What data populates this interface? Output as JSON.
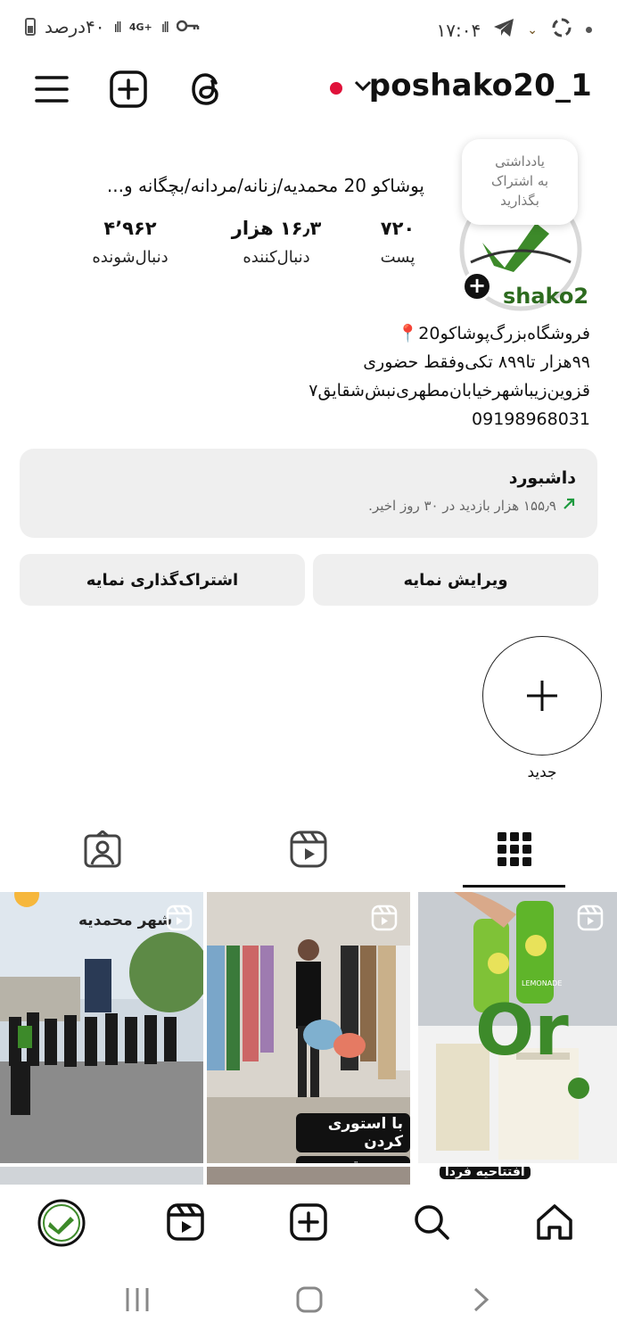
{
  "status_bar": {
    "battery_text": "۴۰درصد",
    "network": "4G+",
    "time": "۱۷:۰۴"
  },
  "header": {
    "username": "poshako20_1"
  },
  "note": {
    "text_line1": "یادداشتی",
    "text_line2": "به اشتراک",
    "text_line3": "بگذارید"
  },
  "avatar": {
    "label": "shako2"
  },
  "profile": {
    "full_name": "پوشاکو 20 محمدیه/زنانه/مردانه/بچگانه و...",
    "stats": {
      "posts_value": "۷۲۰",
      "posts_label": "پست",
      "followers_value": "۱۶٫۳ هزار",
      "followers_label": "دنبال‌کننده",
      "following_value": "۴٬۹۶۲",
      "following_label": "دنبال‌شونده"
    },
    "bio_lines": [
      "فروشگاه‌بزرگ‌پوشاکو20📍",
      "۹۹هزار تا۸۹۹ تکی‌وفقط حضوری",
      "قزوین‌زیباشهرخیابان‌مطهری‌نبش‌شقایق۷",
      "09198968031"
    ]
  },
  "dashboard": {
    "title": "داشبورد",
    "subtitle": "۱۵۵٫۹ هزار بازدید در ۳۰ روز اخیر."
  },
  "buttons": {
    "edit_profile": "ویرایش نمایه",
    "share_profile": "اشتراک‌گذاری نمایه"
  },
  "highlights": {
    "new_label": "جدید"
  },
  "grid": {
    "tile1_caption": "شهر محمدیه",
    "tile2_caption_line1": "با استوری کردن",
    "tile2_caption_line2": "بدون قرعه کشی",
    "tile3_big_text": "Or",
    "tile3_bottle_label": "LEMONADE",
    "tile2b_caption": "افتتاحیه فردا"
  },
  "colors": {
    "accent": "#111111",
    "button_bg": "#efefef",
    "live_dot": "#e0123a",
    "brand_green": "#3d8a2a",
    "trend_green": "#1c9a3e"
  }
}
